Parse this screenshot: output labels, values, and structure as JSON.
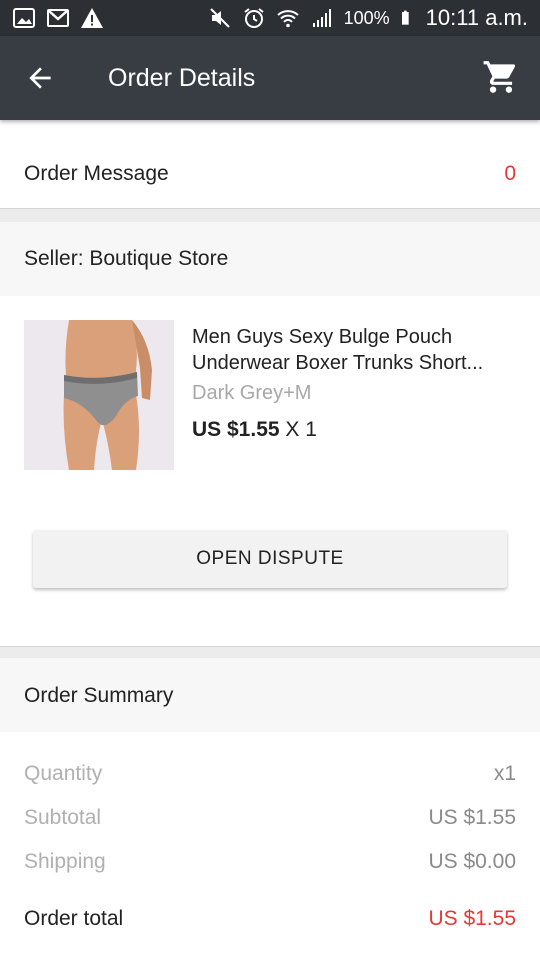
{
  "status_bar": {
    "battery": "100%",
    "time": "10:11 a.m."
  },
  "app_bar": {
    "title": "Order Details"
  },
  "order_message": {
    "label": "Order Message",
    "count": "0"
  },
  "seller": {
    "label": "Seller: Boutique Store"
  },
  "product": {
    "title_line1": "Men Guys Sexy Bulge Pouch",
    "title_line2": "Underwear Boxer Trunks Short...",
    "variant": "Dark Grey+M",
    "price": "US $1.55",
    "quantity": "X 1"
  },
  "actions": {
    "open_dispute": "OPEN DISPUTE"
  },
  "summary": {
    "title": "Order Summary",
    "rows": [
      {
        "label": "Quantity",
        "value": "x1"
      },
      {
        "label": "Subtotal",
        "value": "US $1.55"
      },
      {
        "label": "Shipping",
        "value": "US $0.00"
      }
    ],
    "total_label": "Order total",
    "total_value": "US $1.55"
  },
  "colors": {
    "appbar": "#383d44",
    "statusbar": "#2c2f33",
    "accent_red": "#e53935"
  },
  "icons": [
    "image-icon",
    "gmail-icon",
    "warning-icon",
    "mute-icon",
    "alarm-icon",
    "wifi-icon",
    "signal-icon",
    "battery-icon",
    "back-arrow-icon",
    "cart-icon"
  ]
}
